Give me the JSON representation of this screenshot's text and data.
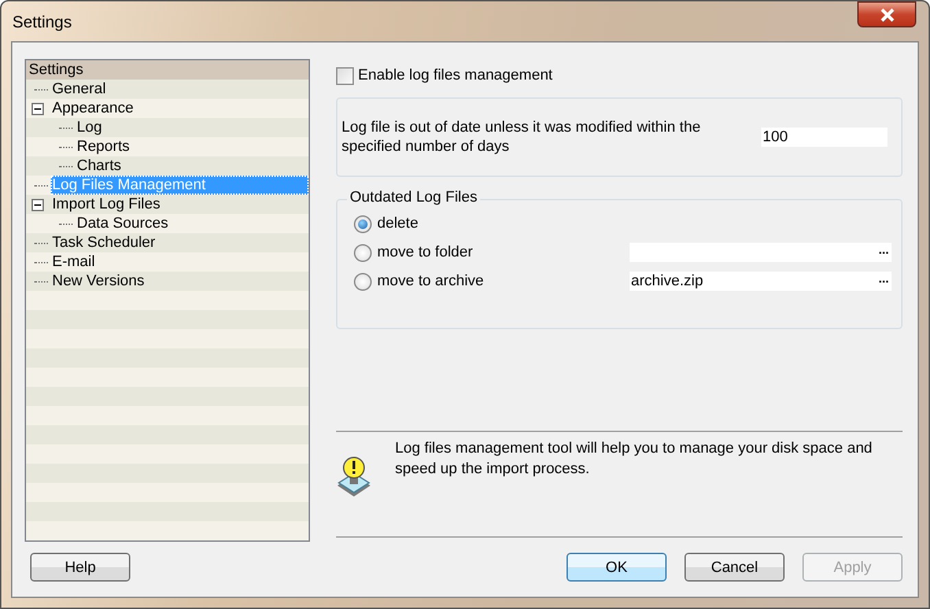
{
  "window": {
    "title": "Settings"
  },
  "tree": {
    "root": "Settings",
    "items": [
      {
        "label": "General",
        "selected": false
      },
      {
        "label": "Appearance",
        "selected": false,
        "expanded": true,
        "children": [
          {
            "label": "Log",
            "selected": false
          },
          {
            "label": "Reports",
            "selected": false
          },
          {
            "label": "Charts",
            "selected": false
          }
        ]
      },
      {
        "label": "Log Files Management",
        "selected": true
      },
      {
        "label": "Import Log Files",
        "selected": false,
        "expanded": true,
        "children": [
          {
            "label": "Data Sources",
            "selected": false
          }
        ]
      },
      {
        "label": "Task Scheduler",
        "selected": false
      },
      {
        "label": "E-mail",
        "selected": false
      },
      {
        "label": "New Versions",
        "selected": false
      }
    ]
  },
  "enable": {
    "label": "Enable log files management",
    "checked": false
  },
  "age": {
    "label": "Log file is out of date unless it was modified within the specified number of days",
    "value": "100"
  },
  "outdated": {
    "title": "Outdated Log Files",
    "options": [
      {
        "label": "delete",
        "selected": true
      },
      {
        "label": "move to folder",
        "selected": false,
        "field": {
          "button": "..."
        }
      },
      {
        "label": "move to archive",
        "selected": false,
        "field": {
          "value": "archive.zip",
          "button": "..."
        }
      }
    ]
  },
  "tip": "Log files management tool will help you to manage your disk space and speed up the import process.",
  "help_button": {
    "label": "Help"
  },
  "buttons": [
    {
      "label": "OK",
      "disabled": false,
      "default": true
    },
    {
      "label": "Cancel",
      "disabled": false,
      "default": false
    },
    {
      "label": "Apply",
      "disabled": true,
      "default": false
    }
  ]
}
